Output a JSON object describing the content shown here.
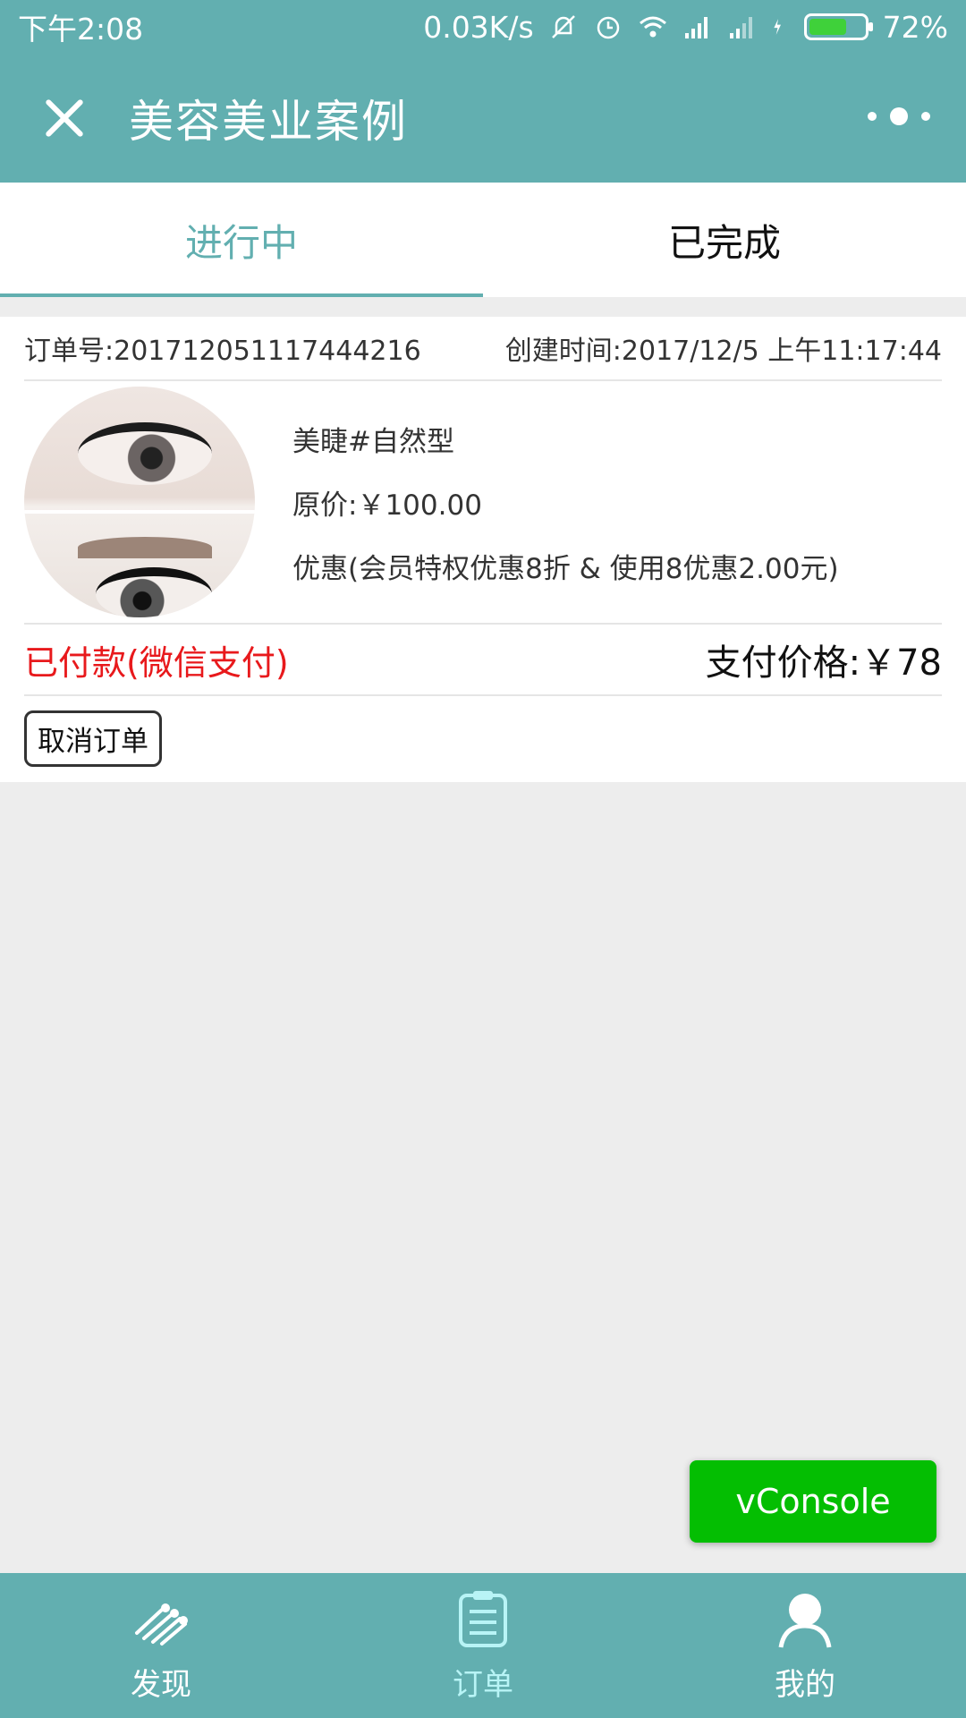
{
  "status_bar": {
    "time": "下午2:08",
    "speed": "0.03K/s",
    "battery": "72%",
    "battery_level": 0.72
  },
  "nav": {
    "title": "美容美业案例"
  },
  "tabs": [
    {
      "label": "进行中",
      "active": true
    },
    {
      "label": "已完成",
      "active": false
    }
  ],
  "order": {
    "number": "订单号:20171205111744421​6",
    "created": "创建时间:2017/12/5 上午11:17:44",
    "product_name": "美睫#自然型",
    "original_price": "原价:￥100.00",
    "discount": "优惠(会员特权优惠8折 & 使用8优惠2.00元)",
    "pay_status": "已付款(微信支付)",
    "pay_price": "支付价格:￥78",
    "cancel_label": "取消订单"
  },
  "vconsole": "vConsole",
  "tabbar": [
    {
      "label": "发现",
      "icon": "discover-icon",
      "active": false
    },
    {
      "label": "订单",
      "icon": "order-icon",
      "active": true
    },
    {
      "label": "我的",
      "icon": "profile-icon",
      "active": false
    }
  ],
  "colors": {
    "theme": "#62afb0",
    "pay_status": "#e8191c",
    "vconsole": "#04be02"
  }
}
